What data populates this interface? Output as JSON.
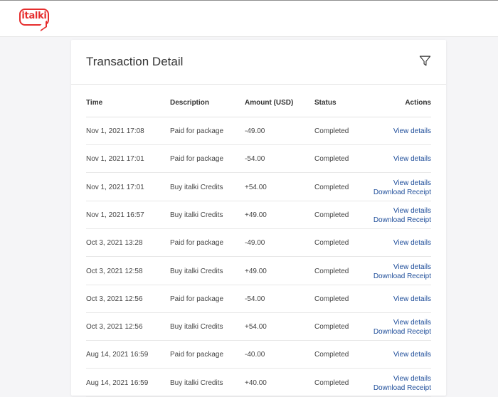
{
  "brand": {
    "logo_text": "italki",
    "color": "#e62e2e"
  },
  "header": {
    "title": "Transaction Detail"
  },
  "icons": {
    "filter": "filter-icon"
  },
  "columns": {
    "time": "Time",
    "description": "Description",
    "amount": "Amount (USD)",
    "status": "Status",
    "actions": "Actions"
  },
  "actions": {
    "view": "View details",
    "download": "Download Receipt"
  },
  "rows": [
    {
      "time": "Nov 1, 2021 17:08",
      "description": "Paid for package",
      "amount": "-49.00",
      "status": "Completed",
      "receipt": false
    },
    {
      "time": "Nov 1, 2021 17:01",
      "description": "Paid for package",
      "amount": "-54.00",
      "status": "Completed",
      "receipt": false
    },
    {
      "time": "Nov 1, 2021 17:01",
      "description": "Buy italki Credits",
      "amount": "+54.00",
      "status": "Completed",
      "receipt": true
    },
    {
      "time": "Nov 1, 2021 16:57",
      "description": "Buy italki Credits",
      "amount": "+49.00",
      "status": "Completed",
      "receipt": true
    },
    {
      "time": "Oct 3, 2021 13:28",
      "description": "Paid for package",
      "amount": "-49.00",
      "status": "Completed",
      "receipt": false
    },
    {
      "time": "Oct 3, 2021 12:58",
      "description": "Buy italki Credits",
      "amount": "+49.00",
      "status": "Completed",
      "receipt": true
    },
    {
      "time": "Oct 3, 2021 12:56",
      "description": "Paid for package",
      "amount": "-54.00",
      "status": "Completed",
      "receipt": false
    },
    {
      "time": "Oct 3, 2021 12:56",
      "description": "Buy italki Credits",
      "amount": "+54.00",
      "status": "Completed",
      "receipt": true
    },
    {
      "time": "Aug 14, 2021 16:59",
      "description": "Paid for package",
      "amount": "-40.00",
      "status": "Completed",
      "receipt": false
    },
    {
      "time": "Aug 14, 2021 16:59",
      "description": "Buy italki Credits",
      "amount": "+40.00",
      "status": "Completed",
      "receipt": true
    }
  ]
}
